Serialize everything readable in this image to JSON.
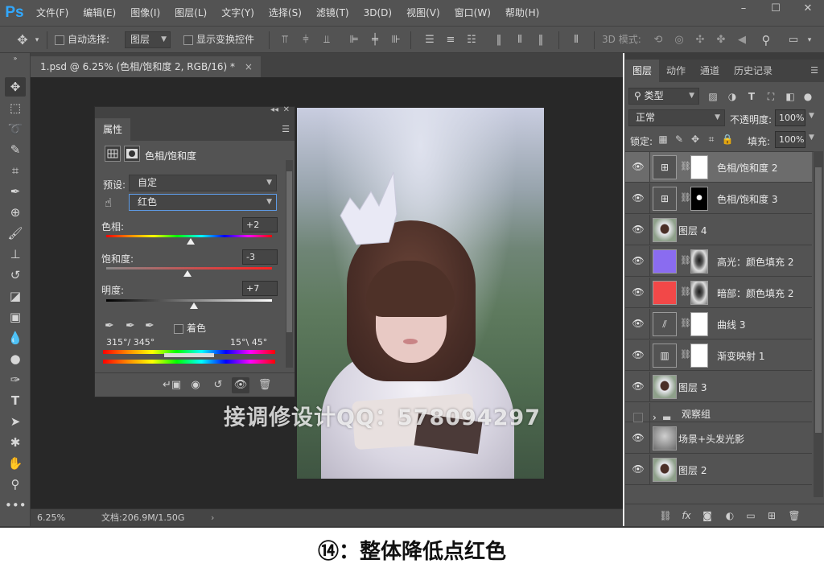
{
  "app": {
    "logo": "Ps",
    "menu": [
      "文件(F)",
      "编辑(E)",
      "图像(I)",
      "图层(L)",
      "文字(Y)",
      "选择(S)",
      "滤镜(T)",
      "3D(D)",
      "视图(V)",
      "窗口(W)",
      "帮助(H)"
    ],
    "window_buttons": [
      "–",
      "☐",
      "✕"
    ]
  },
  "options": {
    "auto_select_label": "自动选择:",
    "auto_select_target": "图层",
    "show_transform_label": "显示变换控件",
    "mode_3d_label": "3D 模式:"
  },
  "document": {
    "tab_title": "1.psd @ 6.25% (色相/饱和度 2, RGB/16) *",
    "tab_close": "×",
    "zoom": "6.25%",
    "doc_info": "文档:206.9M/1.50G",
    "status_arrow": "›"
  },
  "watermark": "接调修设计QQ：578094297",
  "properties": {
    "tab": "属性",
    "adjustment_name": "色相/饱和度",
    "preset_label": "预设:",
    "preset_value": "自定",
    "channel_value": "红色",
    "hue_label": "色相:",
    "hue_value": "+2",
    "hue_fraction": 0.51,
    "saturation_label": "饱和度:",
    "saturation_value": "-3",
    "saturation_fraction": 0.49,
    "lightness_label": "明度:",
    "lightness_value": "+7",
    "lightness_fraction": 0.53,
    "colorize_label": "着色",
    "range_left": "315°/ 345°",
    "range_right": "15°\\ 45°"
  },
  "layers": {
    "tabs": [
      "图层",
      "动作",
      "通道",
      "历史记录"
    ],
    "active_tab": "图层",
    "filter_kind": "类型",
    "blend_mode": "正常",
    "opacity_label": "不透明度:",
    "opacity_value": "100%",
    "lock_label": "锁定:",
    "fill_label": "填充:",
    "fill_value": "100%",
    "items": [
      {
        "name": "色相/饱和度 2",
        "type": "adjustment",
        "icon": "hue-sat-icon",
        "selected": true,
        "mask": "white"
      },
      {
        "name": "色相/饱和度 3",
        "type": "adjustment",
        "icon": "hue-sat-icon",
        "selected": false,
        "mask": "black"
      },
      {
        "name": "图层 4",
        "type": "pixel",
        "selected": false
      },
      {
        "name": "高光：颜色填充 2",
        "type": "fill",
        "fill_color": "#8a6cf0",
        "selected": false,
        "mask": "photo"
      },
      {
        "name": "暗部：颜色填充 2",
        "type": "fill",
        "fill_color": "#f24848",
        "selected": false,
        "mask": "photo"
      },
      {
        "name": "曲线 3",
        "type": "adjustment",
        "icon": "curves-icon",
        "selected": false,
        "mask": "white"
      },
      {
        "name": "渐变映射 1",
        "type": "adjustment",
        "icon": "gradient-map-icon",
        "selected": false,
        "mask": "white"
      },
      {
        "name": "图层 3",
        "type": "pixel",
        "selected": false
      },
      {
        "name": "观察组",
        "type": "group",
        "selected": false,
        "hidden": true
      },
      {
        "name": "场景+头发光影",
        "type": "pixel-gray",
        "selected": false
      },
      {
        "name": "图层 2",
        "type": "pixel",
        "selected": false
      }
    ]
  },
  "caption": "⑭：整体降低点红色",
  "colors": {
    "ui_dark": "#535353",
    "canvas": "#282828",
    "ps_blue": "#31a8ff",
    "selected_layer": "#6c6c6c"
  }
}
